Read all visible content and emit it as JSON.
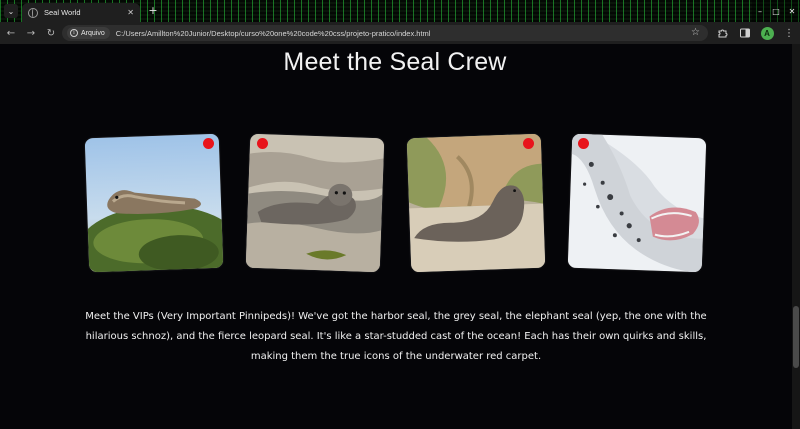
{
  "browser": {
    "tab_title": "Seal World",
    "tab_close": "✕",
    "new_tab": "+",
    "window_controls": [
      "–",
      "□",
      "✕"
    ],
    "site_chip": "Arquivo",
    "url": "C:/Users/Amillton%20Junior/Desktop/curso%20one%20code%20css/projeto-pratico/index.html",
    "profile_initial": "A",
    "icons": {
      "back": "arrow-left-icon",
      "forward": "arrow-right-icon",
      "reload": "reload-icon",
      "info": "info-icon",
      "bookmark": "star-icon",
      "extensions": "puzzle-icon",
      "sidebar": "sidebar-icon",
      "menu": "kebab-menu-icon"
    }
  },
  "page": {
    "title": "Meet the Seal Crew",
    "description": "Meet the VIPs (Very Important Pinnipeds)! We've got the harbor seal, the grey seal, the elephant seal (yep, the one with the hilarious schnoz), and the fierce leopard seal. It's like a star-studded cast of the ocean! Each has their own quirks and skills, making them the true icons of the underwater red carpet.",
    "cards": [
      {
        "subject": "harbor seal resting on a mossy rock",
        "dot_color": "#e8141b"
      },
      {
        "subject": "grey seal lying in shallow water",
        "dot_color": "#e8141b"
      },
      {
        "subject": "seal on a sandy beach below cliffs",
        "dot_color": "#e8141b"
      },
      {
        "subject": "leopard seal with open mouth on snow",
        "dot_color": "#e8141b"
      }
    ]
  },
  "colors": {
    "background": "#050508",
    "title_text": "#f2f2f2",
    "badge_red": "#e8141b",
    "browser_chrome": "#1f1f1f"
  }
}
